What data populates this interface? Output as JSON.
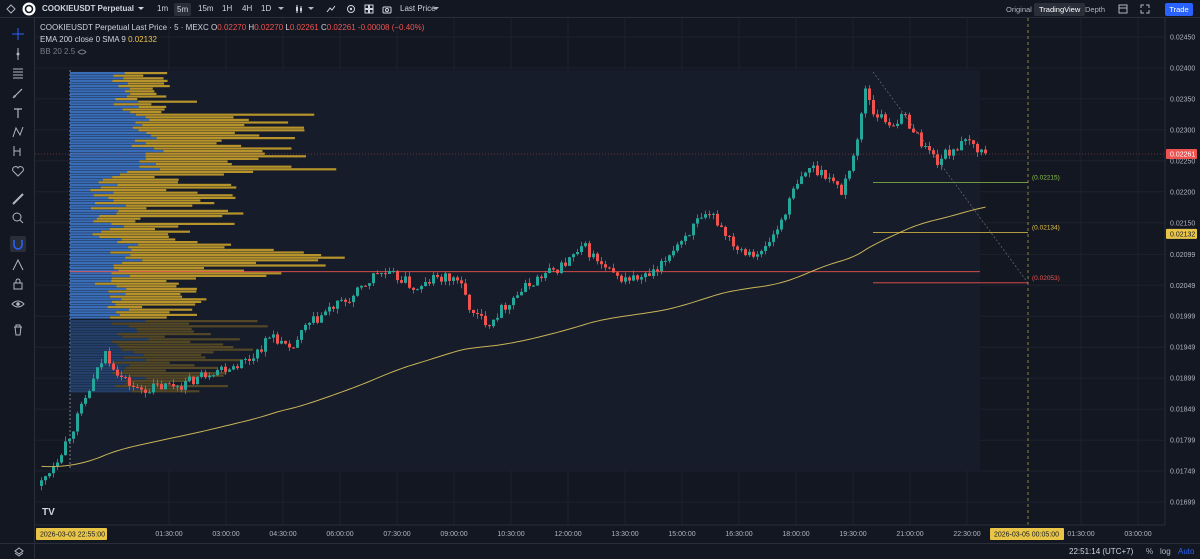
{
  "header": {
    "symbol": "COOKIEUSDT Perpetual",
    "timeframes": [
      "1m",
      "5m",
      "15m",
      "1H",
      "4H",
      "1D"
    ],
    "active_timeframe": "5m",
    "price_type": "Last Price",
    "view_tabs": [
      "Original",
      "TradingView",
      "Depth"
    ],
    "active_view": "TradingView",
    "trade_label": "Trade"
  },
  "legend": {
    "title": "COOKIEUSDT Perpetual Last Price · 5 · MEXC",
    "o_label": "O",
    "o": "0.02270",
    "h_label": "H",
    "h": "0.02270",
    "l_label": "L",
    "l": "0.02261",
    "c_label": "C",
    "c": "0.02261",
    "change": "-0.00008 (−0.40%)",
    "ema_label": "EMA 200 close 0 SMA 9",
    "ema_value": "0.02132",
    "bb_label": "BB 20 2.5"
  },
  "chart_data": {
    "type": "candlestick",
    "y_ticks": [
      "0.02450",
      "0.02400",
      "0.02350",
      "0.02300",
      "0.02250",
      "0.02200",
      "0.02150",
      "0.02099",
      "0.02049",
      "0.01999",
      "0.01949",
      "0.01899",
      "0.01849",
      "0.01799",
      "0.01749",
      "0.01699"
    ],
    "x_ticks": [
      "01:30:00",
      "03:00:00",
      "04:30:00",
      "06:00:00",
      "07:30:00",
      "09:00:00",
      "10:30:00",
      "12:00:00",
      "13:30:00",
      "15:00:00",
      "16:30:00",
      "18:00:00",
      "19:30:00",
      "21:00:00",
      "22:30:00",
      "01:30:00",
      "03:00:00"
    ],
    "crosshair_x_label": "2026-03-03  22:55:00",
    "end_x_label": "2026-03-05  00:05:00",
    "last_price_label": "0.02261",
    "ema_price_label": "0.02132",
    "levels": [
      {
        "label": "(0.02215)",
        "value": 0.02215,
        "color": "#8bc34a"
      },
      {
        "label": "(0.02134)",
        "value": 0.02134,
        "color": "#e8c547"
      },
      {
        "label": "(0.02053)",
        "value": 0.02053,
        "color": "#ef5350"
      }
    ],
    "poc_value": 0.02071,
    "anchors": [
      [
        0,
        0.0173
      ],
      [
        4,
        0.0177
      ],
      [
        8,
        0.0182
      ],
      [
        12,
        0.0188
      ],
      [
        16,
        0.0194
      ],
      [
        20,
        0.019
      ],
      [
        24,
        0.0188
      ],
      [
        30,
        0.01885
      ],
      [
        36,
        0.0189
      ],
      [
        42,
        0.0191
      ],
      [
        48,
        0.0192
      ],
      [
        52,
        0.0193
      ],
      [
        58,
        0.0197
      ],
      [
        62,
        0.0194
      ],
      [
        66,
        0.0198
      ],
      [
        72,
        0.0201
      ],
      [
        78,
        0.0203
      ],
      [
        84,
        0.0207
      ],
      [
        90,
        0.0206
      ],
      [
        94,
        0.0204
      ],
      [
        98,
        0.0206
      ],
      [
        104,
        0.0206
      ],
      [
        108,
        0.02
      ],
      [
        112,
        0.0199
      ],
      [
        118,
        0.0203
      ],
      [
        124,
        0.0206
      ],
      [
        130,
        0.0208
      ],
      [
        136,
        0.0211
      ],
      [
        140,
        0.0208
      ],
      [
        144,
        0.0206
      ],
      [
        150,
        0.0206
      ],
      [
        154,
        0.0207
      ],
      [
        158,
        0.0211
      ],
      [
        164,
        0.0215
      ],
      [
        168,
        0.0216
      ],
      [
        174,
        0.0211
      ],
      [
        180,
        0.021
      ],
      [
        184,
        0.0214
      ],
      [
        188,
        0.022
      ],
      [
        192,
        0.0224
      ],
      [
        196,
        0.0223
      ],
      [
        200,
        0.022
      ],
      [
        204,
        0.0228
      ],
      [
        206,
        0.0237
      ],
      [
        208,
        0.0233
      ],
      [
        212,
        0.0231
      ],
      [
        216,
        0.0232
      ],
      [
        220,
        0.0228
      ],
      [
        224,
        0.0225
      ],
      [
        228,
        0.0227
      ],
      [
        232,
        0.0228
      ],
      [
        236,
        0.02261
      ]
    ]
  },
  "bottom": {
    "time": "22:51:14 (UTC+7)",
    "pct": "%",
    "log": "log",
    "auto": "Auto"
  },
  "colors": {
    "up": "#26a69a",
    "down": "#ef5350",
    "ema": "#c9b458",
    "bg": "#131722",
    "accent": "#2962ff"
  }
}
